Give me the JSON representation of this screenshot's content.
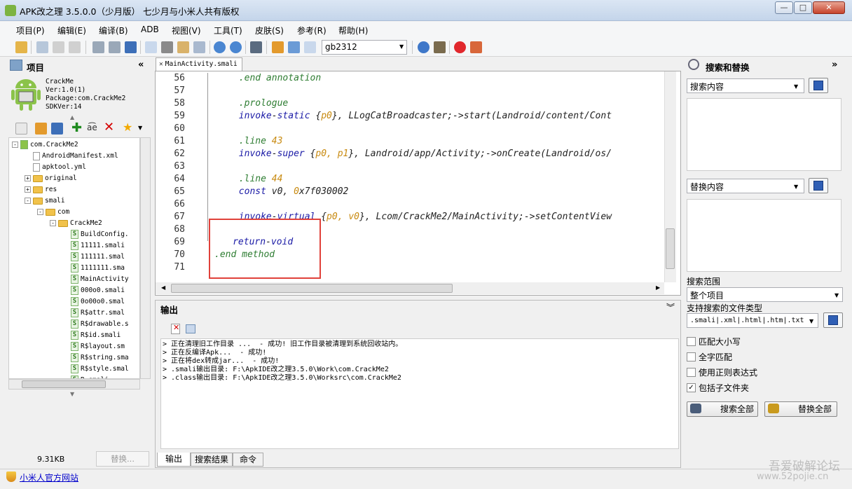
{
  "window": {
    "title": "APK改之理 3.5.0.0（少月版） 七少月与小米人共有版权"
  },
  "menu": [
    "项目(P)",
    "编辑(E)",
    "编译(B)",
    "ADB",
    "视图(V)",
    "工具(T)",
    "皮肤(S)",
    "参考(R)",
    "帮助(H)"
  ],
  "toolbar": {
    "encoding": "gb2312"
  },
  "project": {
    "title": "项目",
    "name": "CrackMe",
    "version": "Ver:1.0(1)",
    "package": "Package:com.CrackMe2",
    "sdk": "SDKVer:14",
    "tree": [
      {
        "label": "com.CrackMe2",
        "indent": 0,
        "type": "root",
        "exp": "-"
      },
      {
        "label": "AndroidManifest.xml",
        "indent": 1,
        "type": "file"
      },
      {
        "label": "apktool.yml",
        "indent": 1,
        "type": "file"
      },
      {
        "label": "original",
        "indent": 1,
        "type": "folder",
        "exp": "+"
      },
      {
        "label": "res",
        "indent": 1,
        "type": "folder",
        "exp": "+"
      },
      {
        "label": "smali",
        "indent": 1,
        "type": "folder",
        "exp": "-"
      },
      {
        "label": "com",
        "indent": 2,
        "type": "folder",
        "exp": "-"
      },
      {
        "label": "CrackMe2",
        "indent": 3,
        "type": "folder",
        "exp": "-"
      },
      {
        "label": "BuildConfig.",
        "indent": 4,
        "type": "smali"
      },
      {
        "label": "11111.smali",
        "indent": 4,
        "type": "smali"
      },
      {
        "label": "111111.smal",
        "indent": 4,
        "type": "smali"
      },
      {
        "label": "1111111.sma",
        "indent": 4,
        "type": "smali"
      },
      {
        "label": "MainActivity",
        "indent": 4,
        "type": "smali"
      },
      {
        "label": "000o0.smali",
        "indent": 4,
        "type": "smali"
      },
      {
        "label": "0o00o0.smal",
        "indent": 4,
        "type": "smali"
      },
      {
        "label": "R$attr.smal",
        "indent": 4,
        "type": "smali"
      },
      {
        "label": "R$drawable.s",
        "indent": 4,
        "type": "smali"
      },
      {
        "label": "R$id.smali",
        "indent": 4,
        "type": "smali"
      },
      {
        "label": "R$layout.sm",
        "indent": 4,
        "type": "smali"
      },
      {
        "label": "R$string.sma",
        "indent": 4,
        "type": "smali"
      },
      {
        "label": "R$style.smal",
        "indent": 4,
        "type": "smali"
      },
      {
        "label": "R.smali",
        "indent": 4,
        "type": "smali"
      }
    ],
    "file_size": "9.31KB",
    "replace_button": "替换..."
  },
  "editor": {
    "tab": "MainActivity.smali",
    "lines": [
      {
        "n": "56",
        "indent": 4,
        "tokens": [
          [
            ".end annotation",
            "dir"
          ]
        ]
      },
      {
        "n": "57",
        "indent": 0,
        "tokens": []
      },
      {
        "n": "58",
        "indent": 4,
        "tokens": [
          [
            ".prologue",
            "dir"
          ]
        ]
      },
      {
        "n": "59",
        "indent": 4,
        "tokens": [
          [
            "invoke",
            "kw"
          ],
          [
            "-",
            "plain"
          ],
          [
            "static",
            "kw"
          ],
          [
            " {",
            "plain"
          ],
          [
            "p0",
            "reg"
          ],
          [
            "}, LLogCatBroadcaster;->start(Landroid/content/Cont",
            "plain"
          ]
        ]
      },
      {
        "n": "60",
        "indent": 0,
        "tokens": []
      },
      {
        "n": "61",
        "indent": 4,
        "tokens": [
          [
            ".line ",
            "dir"
          ],
          [
            "43",
            "reg"
          ]
        ]
      },
      {
        "n": "62",
        "indent": 4,
        "tokens": [
          [
            "invoke",
            "kw"
          ],
          [
            "-",
            "plain"
          ],
          [
            "super",
            "kw"
          ],
          [
            " {",
            "plain"
          ],
          [
            "p0, p1",
            "reg"
          ],
          [
            "}, Landroid/app/Activity;->onCreate(Landroid/os/",
            "plain"
          ]
        ]
      },
      {
        "n": "63",
        "indent": 0,
        "tokens": []
      },
      {
        "n": "64",
        "indent": 4,
        "tokens": [
          [
            ".line ",
            "dir"
          ],
          [
            "44",
            "reg"
          ]
        ]
      },
      {
        "n": "65",
        "indent": 4,
        "tokens": [
          [
            "const",
            "kw"
          ],
          [
            " v0, ",
            "plain"
          ],
          [
            "0",
            "reg"
          ],
          [
            "x7f030002",
            "plain"
          ]
        ]
      },
      {
        "n": "66",
        "indent": 0,
        "tokens": []
      },
      {
        "n": "67",
        "indent": 4,
        "tokens": [
          [
            "invoke",
            "kw"
          ],
          [
            "-",
            "plain"
          ],
          [
            "virtual",
            "kw"
          ],
          [
            " {",
            "plain"
          ],
          [
            "p0, v0",
            "reg"
          ],
          [
            "}, Lcom/CrackMe2/MainActivity;->setContentView",
            "plain"
          ]
        ]
      },
      {
        "n": "68",
        "indent": 0,
        "tokens": []
      },
      {
        "n": "69",
        "indent": 3,
        "tokens": [
          [
            "return",
            "kw"
          ],
          [
            "-",
            "plain"
          ],
          [
            "void",
            "kw"
          ]
        ]
      },
      {
        "n": "70",
        "indent": 0,
        "tokens": [
          [
            ".end method",
            "dir"
          ]
        ]
      },
      {
        "n": "71",
        "indent": 0,
        "tokens": []
      }
    ]
  },
  "output": {
    "title": "输出",
    "lines": [
      "> 正在清理旧工作目录 ...  - 成功! 旧工作目录被清理到系统回收站内。",
      "> 正在反编译Apk...  - 成功!",
      "> 正在将dex转成jar...  - 成功!",
      "> .smali输出目录: F:\\ApkIDE改之理3.5.0\\Work\\com.CrackMe2",
      "> .class输出目录: F:\\ApkIDE改之理3.5.0\\Worksrc\\com.CrackMe2"
    ],
    "tabs": [
      "输出",
      "搜索结果",
      "命令"
    ]
  },
  "search": {
    "title": "搜索和替换",
    "search_label": "搜索内容",
    "replace_label": "替换内容",
    "scope_label": "搜索范围",
    "scope_value": "整个项目",
    "types_label": "支持搜索的文件类型",
    "types_value": ".smali|.xml|.html|.htm|.txt",
    "options": [
      {
        "label": "匹配大小写",
        "checked": false
      },
      {
        "label": "全字匹配",
        "checked": false
      },
      {
        "label": "使用正则表达式",
        "checked": false
      },
      {
        "label": "包括子文件夹",
        "checked": true
      }
    ],
    "search_all": "搜索全部",
    "replace_all": "替换全部"
  },
  "status": {
    "link": "小米人官方网站"
  },
  "watermark": {
    "line1": "吾爱破解论坛",
    "line2": "www.52pojie.cn"
  },
  "colors": {
    "highlight": "#e0413a",
    "keyword": "#1a1aa6",
    "directive": "#2e7d32",
    "register": "#c88a10"
  }
}
